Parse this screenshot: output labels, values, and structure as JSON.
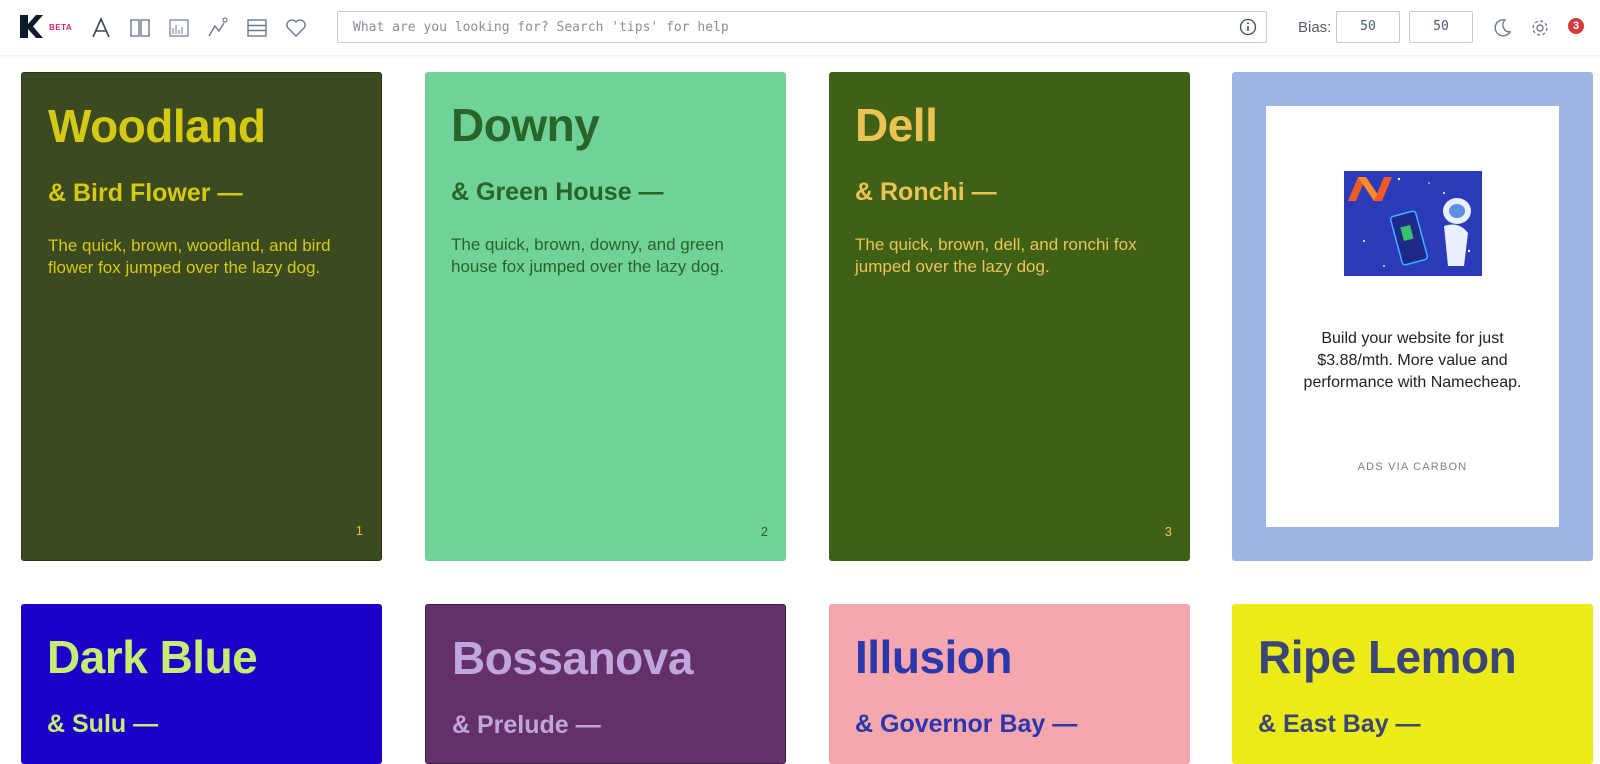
{
  "header": {
    "logo_badge": "BETA",
    "tools": [
      "font-icon",
      "columns-icon",
      "chart-icon",
      "draw-icon",
      "rows-icon",
      "heart-icon"
    ],
    "search_placeholder": "What are you looking for? Search 'tips' for help",
    "bias_label": "Bias:",
    "bias_left": "50",
    "bias_right": "50",
    "notification_count": "3"
  },
  "cards": [
    {
      "name": "Woodland",
      "pair": "& Bird Flower —",
      "sample": "The quick, brown, woodland, and bird flower fox jumped over the lazy dog.",
      "number": "1",
      "bg": "#3b4a1f",
      "fg": "#d4c913"
    },
    {
      "name": "Downy",
      "pair": "& Green House —",
      "sample": "The quick, brown, downy, and green house fox jumped over the lazy dog.",
      "number": "2",
      "bg": "#70d297",
      "fg": "#27652a"
    },
    {
      "name": "Dell",
      "pair": "& Ronchi —",
      "sample": "The quick, brown, dell, and ronchi fox jumped over the lazy dog.",
      "number": "3",
      "bg": "#3f6116",
      "fg": "#ebc355"
    },
    {
      "name": "Dark Blue",
      "pair": "& Sulu —",
      "sample": "",
      "number": "",
      "bg": "#1c00c9",
      "fg": "#c5ed73"
    },
    {
      "name": "Bossanova",
      "pair": "& Prelude —",
      "sample": "",
      "number": "",
      "bg": "#64306a",
      "fg": "#c1a6dc"
    },
    {
      "name": "Illusion",
      "pair": "& Governor Bay —",
      "sample": "",
      "number": "",
      "bg": "#f5a7ad",
      "fg": "#2a37ad"
    },
    {
      "name": "Ripe Lemon",
      "pair": "& East Bay —",
      "sample": "",
      "number": "",
      "bg": "#ebeb17",
      "fg": "#3b4677"
    }
  ],
  "ad": {
    "text": "Build your website for just $3.88/mth. More value and performance with Namecheap.",
    "via": "ADS VIA CARBON"
  }
}
